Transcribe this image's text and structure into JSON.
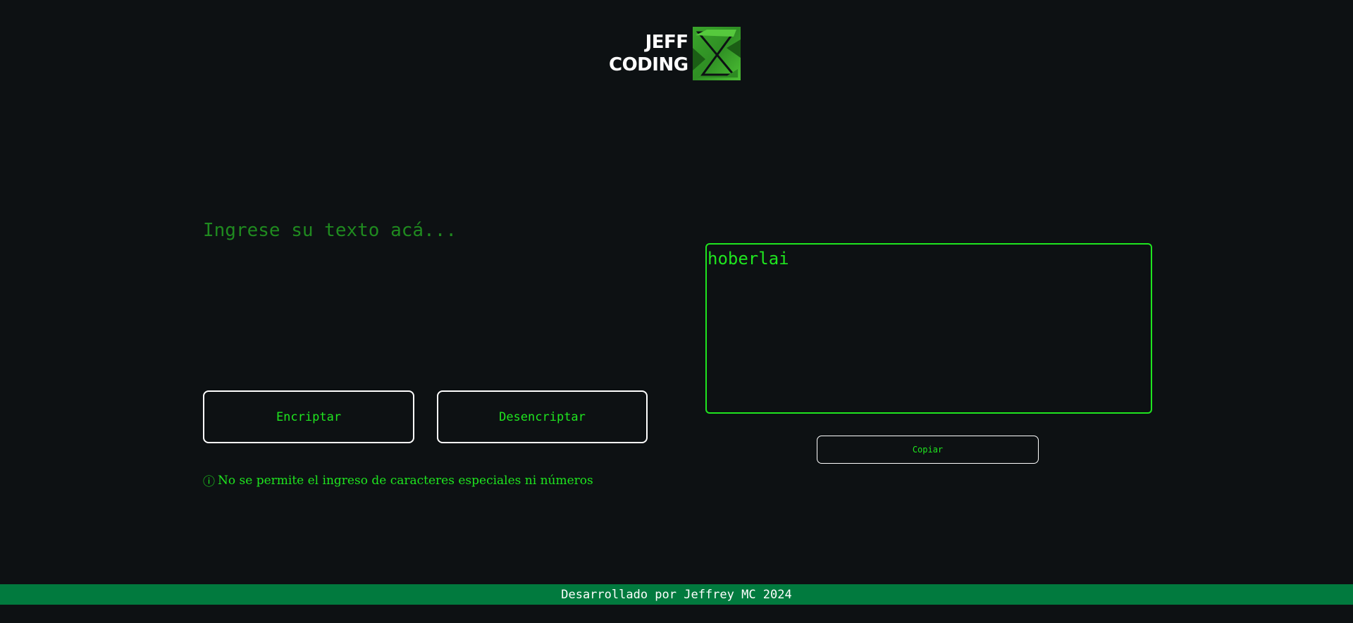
{
  "header": {
    "logo_line1": "JEFF",
    "logo_line2": "CODING"
  },
  "input": {
    "placeholder": "Ingrese su texto acá...",
    "value": ""
  },
  "buttons": {
    "encrypt_label": "Encriptar",
    "decrypt_label": "Desencriptar",
    "copy_label": "Copiar"
  },
  "warning": {
    "icon": "info-circle-icon",
    "icon_glyph": "ⓘ",
    "text": "No se permite el ingreso de caracteres especiales ni números"
  },
  "output": {
    "value": "hoberlai"
  },
  "footer": {
    "text": "Desarrollado por Jeffrey MC 2024"
  },
  "colors": {
    "background": "#0d1113",
    "accent_green": "#1fe51f",
    "footer_bg": "#017a3e",
    "border_white": "#ffffff"
  }
}
